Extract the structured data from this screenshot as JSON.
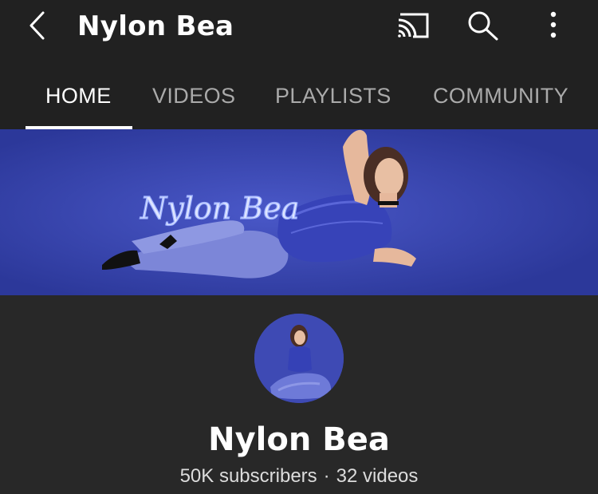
{
  "header": {
    "title": "Nylon Bea",
    "icons": [
      "back-arrow-icon",
      "cast-icon",
      "search-icon",
      "more-vertical-icon"
    ]
  },
  "tabs": [
    {
      "label": "HOME",
      "active": true
    },
    {
      "label": "VIDEOS",
      "active": false
    },
    {
      "label": "PLAYLISTS",
      "active": false
    },
    {
      "label": "COMMUNITY",
      "active": false
    }
  ],
  "banner": {
    "logo_text": "Nylon Bea"
  },
  "channel": {
    "name": "Nylon Bea",
    "subscribers": "50K subscribers",
    "separator": "·",
    "videos": "32 videos"
  },
  "colors": {
    "background": "#282828",
    "header_background": "#212121",
    "banner_blue": "#3946b2",
    "active_tab": "#ffffff",
    "inactive_tab": "#aaaaaa"
  }
}
